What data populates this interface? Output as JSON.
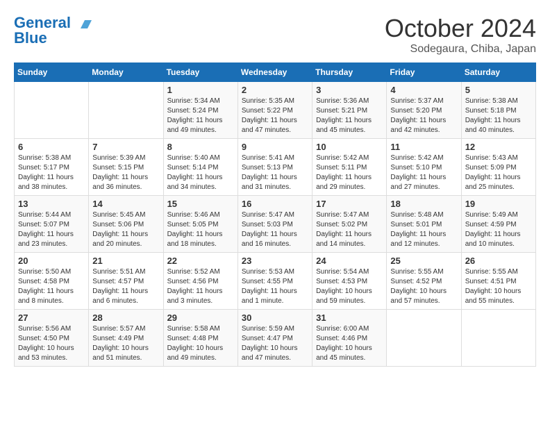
{
  "header": {
    "logo_line1": "General",
    "logo_line2": "Blue",
    "title": "October 2024",
    "location": "Sodegaura, Chiba, Japan"
  },
  "weekdays": [
    "Sunday",
    "Monday",
    "Tuesday",
    "Wednesday",
    "Thursday",
    "Friday",
    "Saturday"
  ],
  "weeks": [
    [
      {
        "day": "",
        "info": ""
      },
      {
        "day": "",
        "info": ""
      },
      {
        "day": "1",
        "info": "Sunrise: 5:34 AM\nSunset: 5:24 PM\nDaylight: 11 hours and 49 minutes."
      },
      {
        "day": "2",
        "info": "Sunrise: 5:35 AM\nSunset: 5:22 PM\nDaylight: 11 hours and 47 minutes."
      },
      {
        "day": "3",
        "info": "Sunrise: 5:36 AM\nSunset: 5:21 PM\nDaylight: 11 hours and 45 minutes."
      },
      {
        "day": "4",
        "info": "Sunrise: 5:37 AM\nSunset: 5:20 PM\nDaylight: 11 hours and 42 minutes."
      },
      {
        "day": "5",
        "info": "Sunrise: 5:38 AM\nSunset: 5:18 PM\nDaylight: 11 hours and 40 minutes."
      }
    ],
    [
      {
        "day": "6",
        "info": "Sunrise: 5:38 AM\nSunset: 5:17 PM\nDaylight: 11 hours and 38 minutes."
      },
      {
        "day": "7",
        "info": "Sunrise: 5:39 AM\nSunset: 5:15 PM\nDaylight: 11 hours and 36 minutes."
      },
      {
        "day": "8",
        "info": "Sunrise: 5:40 AM\nSunset: 5:14 PM\nDaylight: 11 hours and 34 minutes."
      },
      {
        "day": "9",
        "info": "Sunrise: 5:41 AM\nSunset: 5:13 PM\nDaylight: 11 hours and 31 minutes."
      },
      {
        "day": "10",
        "info": "Sunrise: 5:42 AM\nSunset: 5:11 PM\nDaylight: 11 hours and 29 minutes."
      },
      {
        "day": "11",
        "info": "Sunrise: 5:42 AM\nSunset: 5:10 PM\nDaylight: 11 hours and 27 minutes."
      },
      {
        "day": "12",
        "info": "Sunrise: 5:43 AM\nSunset: 5:09 PM\nDaylight: 11 hours and 25 minutes."
      }
    ],
    [
      {
        "day": "13",
        "info": "Sunrise: 5:44 AM\nSunset: 5:07 PM\nDaylight: 11 hours and 23 minutes."
      },
      {
        "day": "14",
        "info": "Sunrise: 5:45 AM\nSunset: 5:06 PM\nDaylight: 11 hours and 20 minutes."
      },
      {
        "day": "15",
        "info": "Sunrise: 5:46 AM\nSunset: 5:05 PM\nDaylight: 11 hours and 18 minutes."
      },
      {
        "day": "16",
        "info": "Sunrise: 5:47 AM\nSunset: 5:03 PM\nDaylight: 11 hours and 16 minutes."
      },
      {
        "day": "17",
        "info": "Sunrise: 5:47 AM\nSunset: 5:02 PM\nDaylight: 11 hours and 14 minutes."
      },
      {
        "day": "18",
        "info": "Sunrise: 5:48 AM\nSunset: 5:01 PM\nDaylight: 11 hours and 12 minutes."
      },
      {
        "day": "19",
        "info": "Sunrise: 5:49 AM\nSunset: 4:59 PM\nDaylight: 11 hours and 10 minutes."
      }
    ],
    [
      {
        "day": "20",
        "info": "Sunrise: 5:50 AM\nSunset: 4:58 PM\nDaylight: 11 hours and 8 minutes."
      },
      {
        "day": "21",
        "info": "Sunrise: 5:51 AM\nSunset: 4:57 PM\nDaylight: 11 hours and 6 minutes."
      },
      {
        "day": "22",
        "info": "Sunrise: 5:52 AM\nSunset: 4:56 PM\nDaylight: 11 hours and 3 minutes."
      },
      {
        "day": "23",
        "info": "Sunrise: 5:53 AM\nSunset: 4:55 PM\nDaylight: 11 hours and 1 minute."
      },
      {
        "day": "24",
        "info": "Sunrise: 5:54 AM\nSunset: 4:53 PM\nDaylight: 10 hours and 59 minutes."
      },
      {
        "day": "25",
        "info": "Sunrise: 5:55 AM\nSunset: 4:52 PM\nDaylight: 10 hours and 57 minutes."
      },
      {
        "day": "26",
        "info": "Sunrise: 5:55 AM\nSunset: 4:51 PM\nDaylight: 10 hours and 55 minutes."
      }
    ],
    [
      {
        "day": "27",
        "info": "Sunrise: 5:56 AM\nSunset: 4:50 PM\nDaylight: 10 hours and 53 minutes."
      },
      {
        "day": "28",
        "info": "Sunrise: 5:57 AM\nSunset: 4:49 PM\nDaylight: 10 hours and 51 minutes."
      },
      {
        "day": "29",
        "info": "Sunrise: 5:58 AM\nSunset: 4:48 PM\nDaylight: 10 hours and 49 minutes."
      },
      {
        "day": "30",
        "info": "Sunrise: 5:59 AM\nSunset: 4:47 PM\nDaylight: 10 hours and 47 minutes."
      },
      {
        "day": "31",
        "info": "Sunrise: 6:00 AM\nSunset: 4:46 PM\nDaylight: 10 hours and 45 minutes."
      },
      {
        "day": "",
        "info": ""
      },
      {
        "day": "",
        "info": ""
      }
    ]
  ]
}
